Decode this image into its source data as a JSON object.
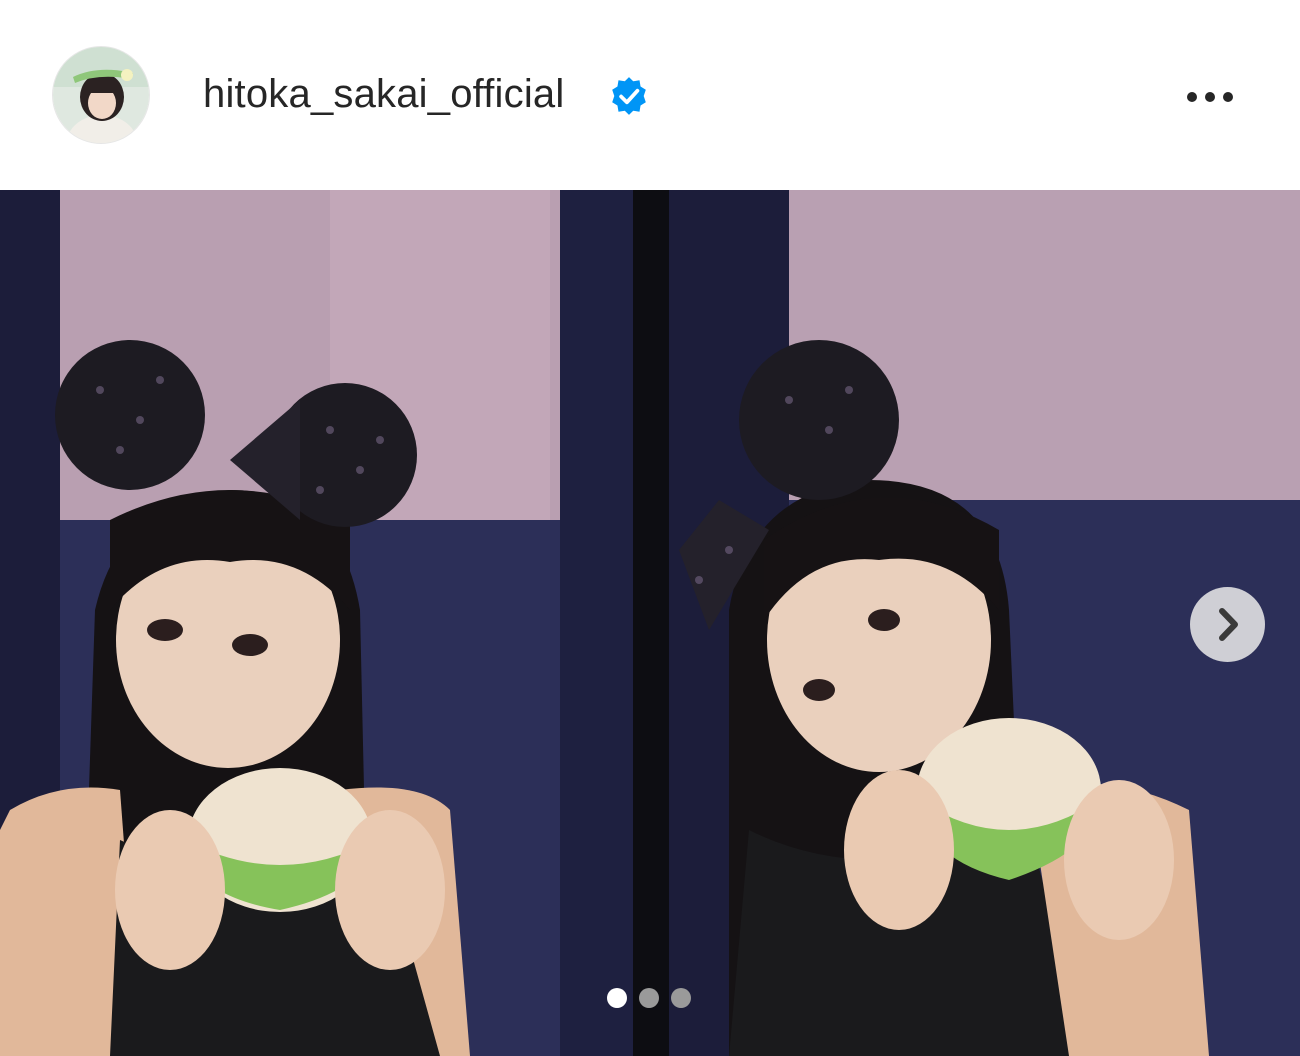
{
  "post": {
    "username": "hitoka_sakai_official",
    "verified": true,
    "more_options_icon": "more-horizontal-icon",
    "verified_icon": "verified-badge-icon",
    "next_icon": "chevron-right-icon",
    "carousel": {
      "total": 3,
      "active_index": 0
    }
  },
  "colors": {
    "verified": "#0095f6",
    "text": "#262626",
    "wall_upper": "#b99fb1",
    "wall_lower": "#2a2d55",
    "dot_active": "#ffffff",
    "dot_inactive": "#9a9a9a"
  }
}
